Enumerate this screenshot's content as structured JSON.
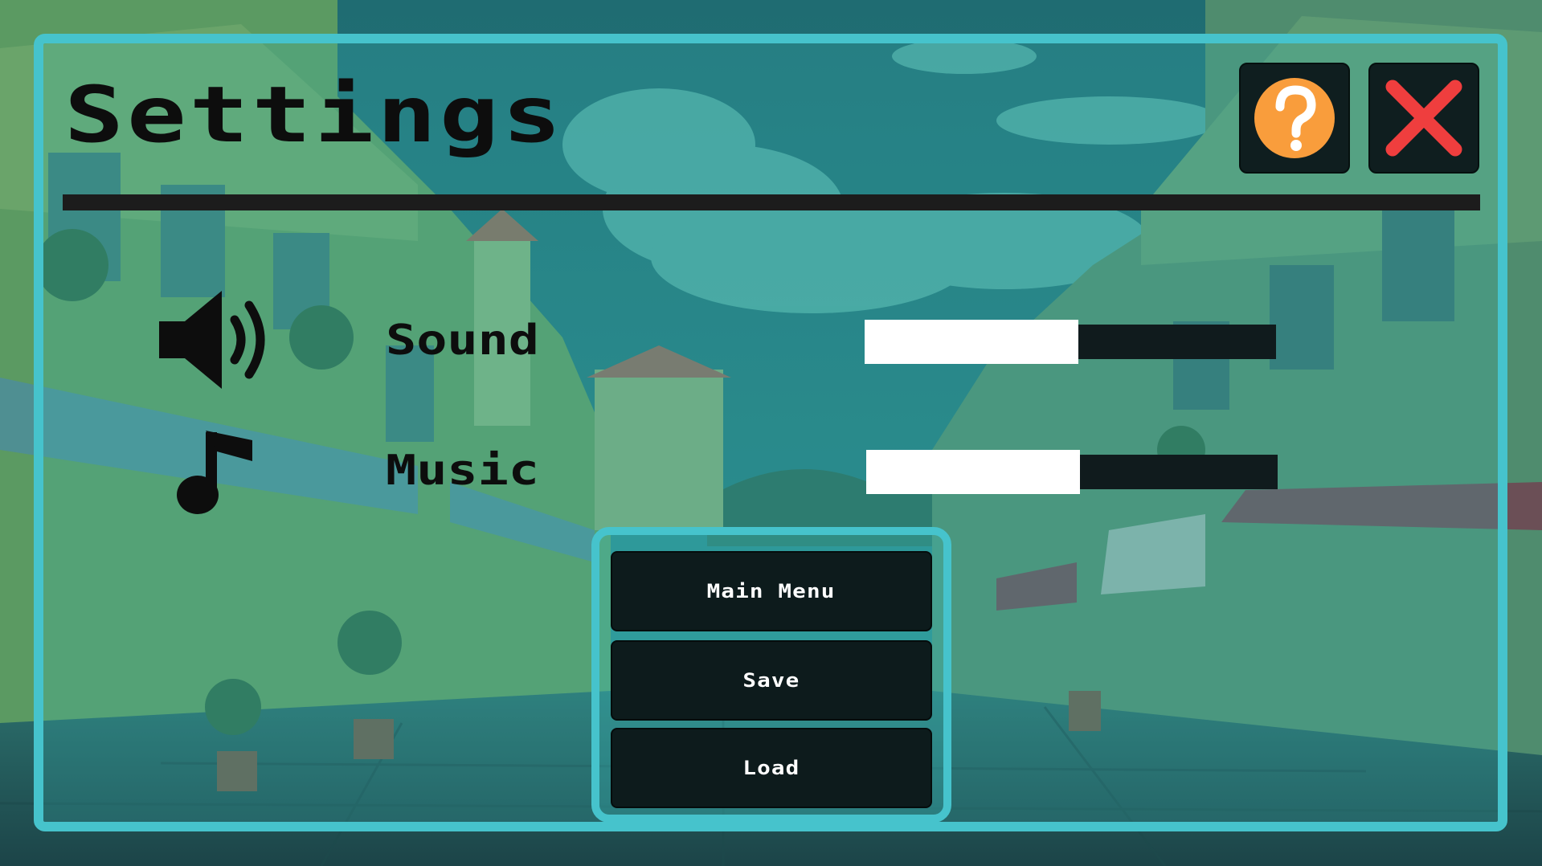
{
  "settings": {
    "title": "Settings",
    "help_icon": "question-mark-icon",
    "close_icon": "close-x-icon",
    "sound": {
      "label": "Sound",
      "icon": "speaker-icon",
      "volume_fraction": 0.52
    },
    "music": {
      "label": "Music",
      "icon": "music-note-icon",
      "volume_fraction": 0.52
    }
  },
  "menu": {
    "main_menu_label": "Main Menu",
    "save_label": "Save",
    "load_label": "Load"
  },
  "colors": {
    "panel_border": "#46c3cc",
    "help_orange": "#f99d3c",
    "close_red": "#ef3e3e",
    "button_dark": "#0d1b1c",
    "slider_fill": "#ffffff"
  }
}
